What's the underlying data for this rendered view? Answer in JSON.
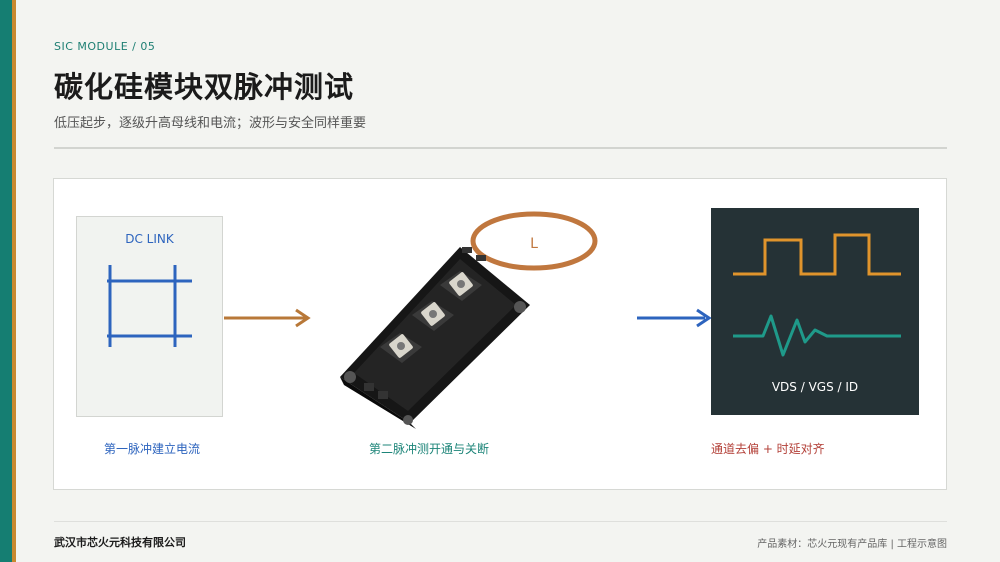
{
  "header": {
    "kicker": "SIC MODULE / 05",
    "title": "碳化硅模块双脉冲测试",
    "subtitle": "低压起步，逐级升高母线和电流；波形与安全同样重要"
  },
  "diagram": {
    "dc_link_label": "DC LINK",
    "inductor_label": "L",
    "scope_label": "VDS / VGS / ID",
    "captions": {
      "step1": "第一脉冲建立电流",
      "step2": "第二脉冲测开通与关断",
      "step3": "通道去偏 + 时延对齐"
    }
  },
  "footer": {
    "company": "武汉市芯火元科技有限公司",
    "credit": "产品素材：芯火元现有产品库 | 工程示意图"
  },
  "colors": {
    "accent_teal": "#157e72",
    "accent_orange": "#c8892f",
    "dc_blue": "#2d64be",
    "arrow_orange": "#b87838",
    "waveform_orange": "#e0942c",
    "waveform_teal": "#1f9a8a",
    "caption_red": "#b34038"
  },
  "icons": [
    "inductor-coil-icon",
    "sic-power-module-icon",
    "oscilloscope-waveform-icon"
  ]
}
